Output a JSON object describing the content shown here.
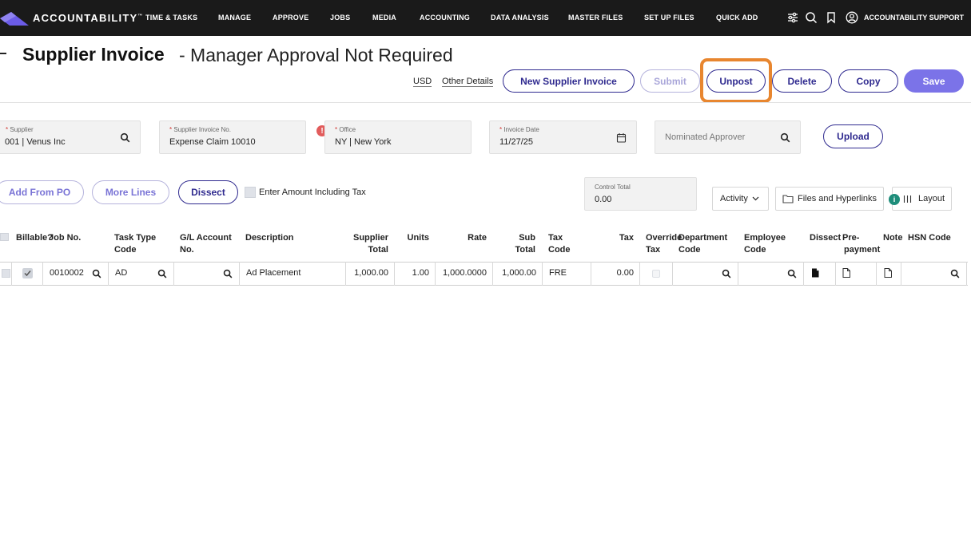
{
  "nav": {
    "brand": "ACCOUNTABILITY",
    "brand_tm": "™",
    "items": [
      "TIME & TASKS",
      "MANAGE",
      "APPROVE",
      "JOBS",
      "MEDIA",
      "ACCOUNTING",
      "DATA ANALYSIS",
      "MASTER FILES",
      "SET UP FILES",
      "QUICK ADD"
    ],
    "user": "ACCOUNTABILITY SUPPORT"
  },
  "page": {
    "title": "Supplier Invoice",
    "subtitle": "- Manager Approval Not Required",
    "currency": "USD",
    "other_details": "Other Details"
  },
  "actions": {
    "new_invoice": "New Supplier Invoice",
    "submit": "Submit",
    "unpost": "Unpost",
    "delete": "Delete",
    "copy": "Copy",
    "save": "Save"
  },
  "fields": {
    "supplier": {
      "label": "Supplier",
      "value": "001 | Venus Inc"
    },
    "invoice_no": {
      "label": "Supplier Invoice No.",
      "value": "Expense Claim 10010"
    },
    "office": {
      "label": "Office",
      "value": "NY | New York"
    },
    "invoice_date": {
      "label": "Invoice Date",
      "value": "11/27/25"
    },
    "approver": {
      "placeholder": "Nominated Approver"
    },
    "upload": "Upload",
    "alert": "!"
  },
  "toolbar": {
    "add_from_po": "Add From PO",
    "more_lines": "More Lines",
    "dissect": "Dissect",
    "enter_amount_tax": "Enter Amount Including Tax",
    "control_total_label": "Control Total",
    "control_total_value": "0.00",
    "activity": "Activity",
    "files": "Files and Hyperlinks",
    "layout": "Layout",
    "info": "i"
  },
  "table": {
    "headers": {
      "billable": "Billable?",
      "job_no": "Job No.",
      "task_type_1": "Task Type",
      "task_type_2": "Code",
      "gl_1": "G/L Account",
      "gl_2": "No.",
      "description": "Description",
      "supplier_total_1": "Supplier",
      "supplier_total_2": "Total",
      "units": "Units",
      "rate": "Rate",
      "sub_total_1": "Sub",
      "sub_total_2": "Total",
      "tax_code_1": "Tax",
      "tax_code_2": "Code",
      "tax": "Tax",
      "override_1": "Override",
      "override_2": "Tax",
      "department_1": "Department",
      "department_2": "Code",
      "employee_1": "Employee",
      "employee_2": "Code",
      "dissect": "Dissect",
      "prepayment_1": "Pre-",
      "prepayment_2": "payment",
      "note": "Note",
      "hsn": "HSN Code"
    },
    "row": {
      "job_no": "0010002",
      "task_type": "AD",
      "gl_account": "",
      "description": "Ad Placement",
      "supplier_total": "1,000.00",
      "units": "1.00",
      "rate": "1,000.0000",
      "sub_total": "1,000.00",
      "tax_code": "FRE",
      "tax": "0.00"
    }
  },
  "colors": {
    "nav_bg": "#1a1a1a",
    "primary": "#2f2a8f",
    "save": "#7b73e8",
    "highlight": "#e8862f",
    "alert": "#e25c5c",
    "info": "#1e8d7a"
  }
}
